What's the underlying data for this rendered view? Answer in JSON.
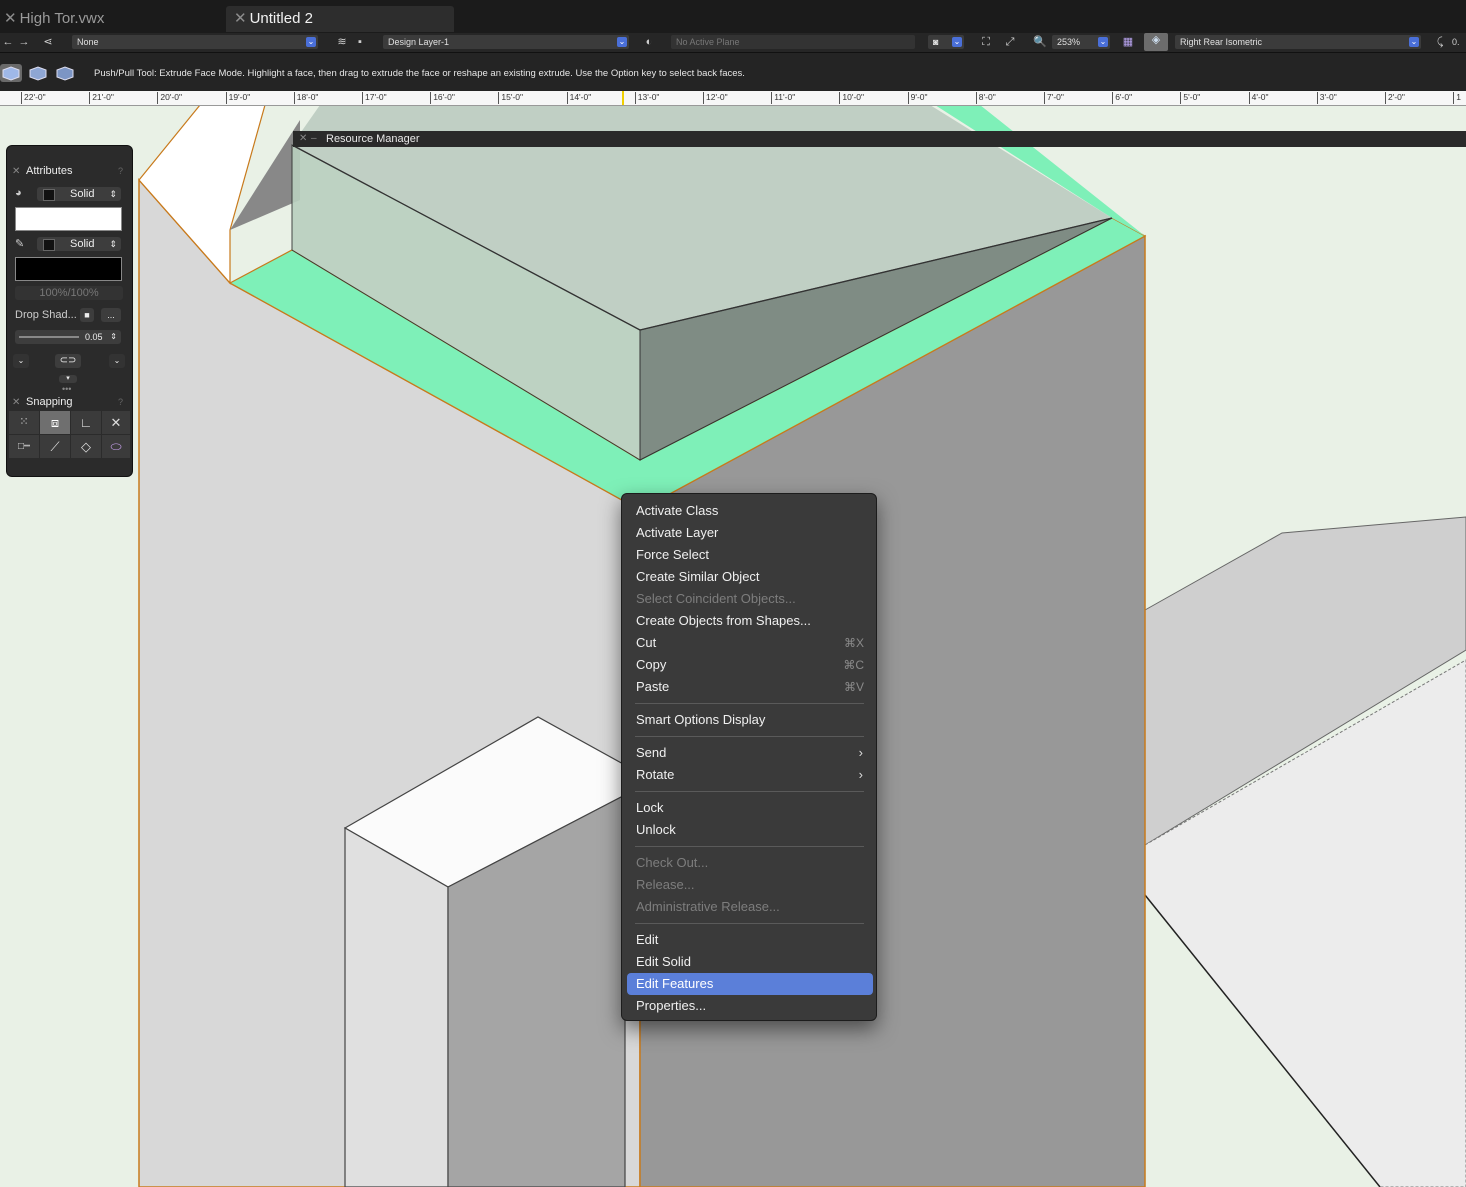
{
  "tabs": [
    {
      "label": "High Tor.vwx"
    },
    {
      "label": "Untitled 2"
    }
  ],
  "view_bar": {
    "class_value": "None",
    "layer_value": "Design Layer-1",
    "plane_value": "No Active Plane",
    "zoom_value": "253%",
    "view_value": "Right Rear Isometric",
    "extra_value": "0."
  },
  "mode_bar": {
    "help_text": "Push/Pull Tool: Extrude Face Mode. Highlight a face, then drag to extrude the face or reshape an existing extrude. Use the Option key to select back faces."
  },
  "ruler": {
    "labels": [
      "22'-0\"",
      "21'-0\"",
      "20'-0\"",
      "19'-0\"",
      "18'-0\"",
      "17'-0\"",
      "16'-0\"",
      "15'-0\"",
      "14'-0\"",
      "13'-0\"",
      "12'-0\"",
      "11'-0\"",
      "10'-0\"",
      "9'-0\"",
      "8'-0\"",
      "7'-0\"",
      "6'-0\"",
      "5'-0\"",
      "4'-0\"",
      "3'-0\"",
      "2'-0\"",
      "1"
    ]
  },
  "resource_manager": {
    "title": "Resource Manager"
  },
  "attributes": {
    "title": "Attributes",
    "help": "?",
    "fill_style": "Solid",
    "pen_style": "Solid",
    "opacity": "100%/100%",
    "drop_shadow_label": "Drop Shad...",
    "drop_shadow_more": "...",
    "thickness": "0.05",
    "fill_color": "#ffffff",
    "pen_color": "#000000"
  },
  "snapping": {
    "title": "Snapping",
    "help": "?"
  },
  "context_menu": {
    "items": [
      {
        "label": "Activate Class",
        "enabled": true
      },
      {
        "label": "Activate Layer",
        "enabled": true
      },
      {
        "label": "Force Select",
        "enabled": true
      },
      {
        "label": "Create Similar Object",
        "enabled": true
      },
      {
        "label": "Select Coincident Objects...",
        "enabled": false
      },
      {
        "label": "Create Objects from Shapes...",
        "enabled": true
      },
      {
        "label": "Cut",
        "shortcut": "⌘X",
        "enabled": true
      },
      {
        "label": "Copy",
        "shortcut": "⌘C",
        "enabled": true
      },
      {
        "label": "Paste",
        "shortcut": "⌘V",
        "enabled": true
      },
      {
        "label": "Smart Options Display",
        "enabled": true
      },
      {
        "label": "Send",
        "submenu": "›",
        "enabled": true
      },
      {
        "label": "Rotate",
        "submenu": "›",
        "enabled": true
      },
      {
        "label": "Lock",
        "enabled": true
      },
      {
        "label": "Unlock",
        "enabled": true
      },
      {
        "label": "Check Out...",
        "enabled": false
      },
      {
        "label": "Release...",
        "enabled": false
      },
      {
        "label": "Administrative Release...",
        "enabled": false
      },
      {
        "label": "Edit",
        "enabled": true
      },
      {
        "label": "Edit Solid",
        "enabled": true
      },
      {
        "label": "Edit Features",
        "enabled": true,
        "highlighted": true
      },
      {
        "label": "Properties...",
        "enabled": true
      }
    ]
  },
  "colors": {
    "selection_highlight": "#5b7fd9",
    "face_highlight": "#7ef0b8",
    "object_outline": "#c87a1c",
    "menu_bg": "#3a3a3a"
  }
}
